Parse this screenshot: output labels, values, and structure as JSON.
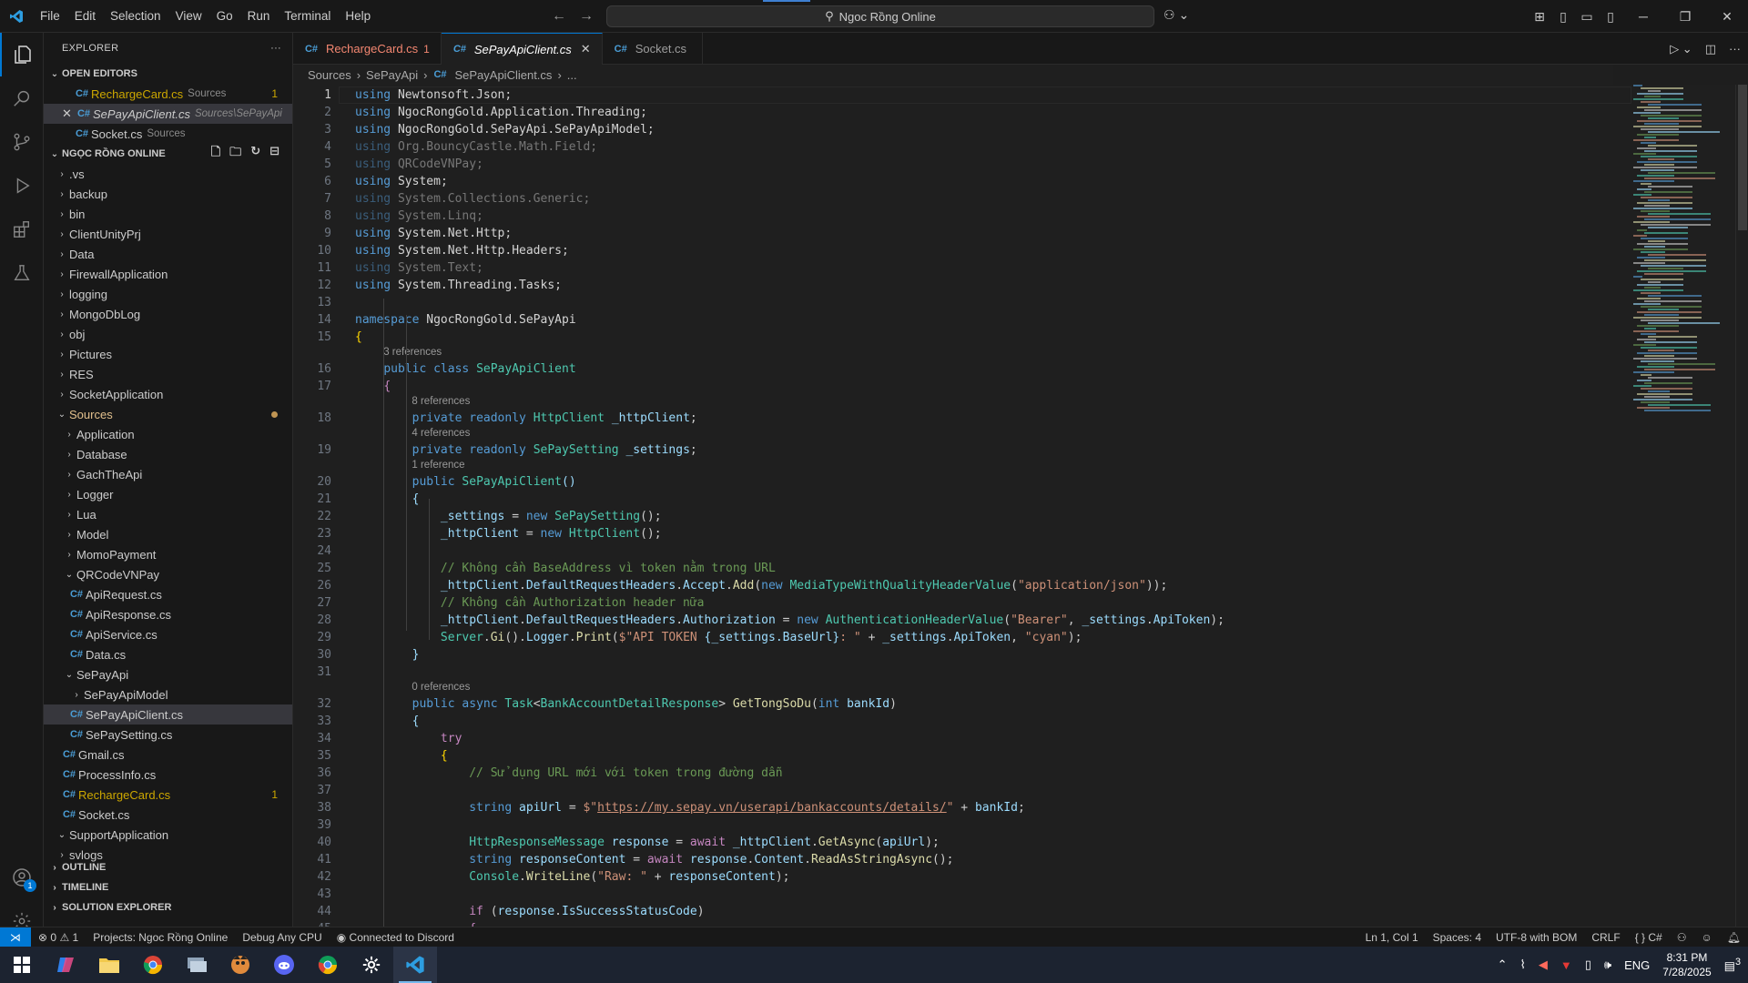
{
  "titlebar": {
    "menu": [
      "File",
      "Edit",
      "Selection",
      "View",
      "Go",
      "Run",
      "Terminal",
      "Help"
    ],
    "search": "Ngoc Rồng Online"
  },
  "explorer": {
    "title": "EXPLORER",
    "open_editors_title": "OPEN EDITORS",
    "open_editors": [
      {
        "name": "RechargeCard.cs",
        "desc": "Sources",
        "count": "1"
      },
      {
        "name": "SePayApiClient.cs",
        "desc": "Sources\\SePayApi",
        "count": ""
      },
      {
        "name": "Socket.cs",
        "desc": "Sources",
        "count": ""
      }
    ],
    "project_title": "NGỌC RỒNG ONLINE",
    "tree": [
      {
        "label": ".vs",
        "type": "folder",
        "depth": 0,
        "open": false
      },
      {
        "label": "backup",
        "type": "folder",
        "depth": 0,
        "open": false
      },
      {
        "label": "bin",
        "type": "folder",
        "depth": 0,
        "open": false
      },
      {
        "label": "ClientUnityPrj",
        "type": "folder",
        "depth": 0,
        "open": false
      },
      {
        "label": "Data",
        "type": "folder",
        "depth": 0,
        "open": false
      },
      {
        "label": "FirewallApplication",
        "type": "folder",
        "depth": 0,
        "open": false
      },
      {
        "label": "logging",
        "type": "folder",
        "depth": 0,
        "open": false
      },
      {
        "label": "MongoDbLog",
        "type": "folder",
        "depth": 0,
        "open": false
      },
      {
        "label": "obj",
        "type": "folder",
        "depth": 0,
        "open": false
      },
      {
        "label": "Pictures",
        "type": "folder",
        "depth": 0,
        "open": false
      },
      {
        "label": "RES",
        "type": "folder",
        "depth": 0,
        "open": false
      },
      {
        "label": "SocketApplication",
        "type": "folder",
        "depth": 0,
        "open": false
      },
      {
        "label": "Sources",
        "type": "folder",
        "depth": 0,
        "open": true,
        "warn": true
      },
      {
        "label": "Application",
        "type": "folder",
        "depth": 1,
        "open": false
      },
      {
        "label": "Database",
        "type": "folder",
        "depth": 1,
        "open": false
      },
      {
        "label": "GachTheApi",
        "type": "folder",
        "depth": 1,
        "open": false
      },
      {
        "label": "Logger",
        "type": "folder",
        "depth": 1,
        "open": false
      },
      {
        "label": "Lua",
        "type": "folder",
        "depth": 1,
        "open": false
      },
      {
        "label": "Model",
        "type": "folder",
        "depth": 1,
        "open": false
      },
      {
        "label": "MomoPayment",
        "type": "folder",
        "depth": 1,
        "open": false
      },
      {
        "label": "QRCodeVNPay",
        "type": "folder",
        "depth": 1,
        "open": true
      },
      {
        "label": "ApiRequest.cs",
        "type": "file",
        "depth": 2
      },
      {
        "label": "ApiResponse.cs",
        "type": "file",
        "depth": 2
      },
      {
        "label": "ApiService.cs",
        "type": "file",
        "depth": 2
      },
      {
        "label": "Data.cs",
        "type": "file",
        "depth": 2
      },
      {
        "label": "SePayApi",
        "type": "folder",
        "depth": 1,
        "open": true
      },
      {
        "label": "SePayApiModel",
        "type": "folder",
        "depth": 2,
        "open": false
      },
      {
        "label": "SePayApiClient.cs",
        "type": "file",
        "depth": 2,
        "selected": true
      },
      {
        "label": "SePaySetting.cs",
        "type": "file",
        "depth": 2
      },
      {
        "label": "Gmail.cs",
        "type": "file",
        "depth": 1
      },
      {
        "label": "ProcessInfo.cs",
        "type": "file",
        "depth": 1
      },
      {
        "label": "RechargeCard.cs",
        "type": "file",
        "depth": 1,
        "error": "1"
      },
      {
        "label": "Socket.cs",
        "type": "file",
        "depth": 1
      },
      {
        "label": "SupportApplication",
        "type": "folder",
        "depth": 0,
        "open": true
      },
      {
        "label": "svlogs",
        "type": "folder",
        "depth": 0,
        "open": false
      }
    ],
    "bottom_sections": [
      "OUTLINE",
      "TIMELINE",
      "SOLUTION EXPLORER"
    ]
  },
  "tabs": [
    {
      "label": "RechargeCard.cs",
      "count": "1",
      "active": false
    },
    {
      "label": "SePayApiClient.cs",
      "count": "",
      "active": true
    },
    {
      "label": "Socket.cs",
      "count": "",
      "active": false
    }
  ],
  "breadcrumb": [
    "Sources",
    "SePayApi",
    "SePayApiClient.cs",
    "..."
  ],
  "editor": {
    "lines": [
      {
        "n": "1",
        "html": "<span class='k'>using</span> <span class='ns'>Newtonsoft.Json</span>;"
      },
      {
        "n": "2",
        "html": "<span class='k'>using</span> <span class='ns'>NgocRongGold.Application.Threading</span>;"
      },
      {
        "n": "3",
        "html": "<span class='k'>using</span> <span class='ns'>NgocRongGold.SePayApi.SePayApiModel</span>;"
      },
      {
        "n": "4",
        "html": "<span class='dim'><span class='k'>using</span> Org.BouncyCastle.Math.Field;</span>"
      },
      {
        "n": "5",
        "html": "<span class='dim'><span class='k'>using</span> QRCodeVNPay;</span>"
      },
      {
        "n": "6",
        "html": "<span class='k'>using</span> <span class='ns'>System</span>;"
      },
      {
        "n": "7",
        "html": "<span class='dim'><span class='k'>using</span> System.Collections.Generic;</span>"
      },
      {
        "n": "8",
        "html": "<span class='dim'><span class='k'>using</span> System.Linq;</span>"
      },
      {
        "n": "9",
        "html": "<span class='k'>using</span> <span class='ns'>System.Net.Http</span>;"
      },
      {
        "n": "10",
        "html": "<span class='k'>using</span> <span class='ns'>System.Net.Http.Headers</span>;"
      },
      {
        "n": "11",
        "html": "<span class='dim'><span class='k'>using</span> System.Text;</span>"
      },
      {
        "n": "12",
        "html": "<span class='k'>using</span> <span class='ns'>System.Threading.Tasks</span>;"
      },
      {
        "n": "13",
        "html": ""
      },
      {
        "n": "14",
        "html": "<span class='k'>namespace</span> <span class='ns'>NgocRongGold.SePayApi</span>"
      },
      {
        "n": "15",
        "html": "<span class='y'>{</span>"
      },
      {
        "n": "16",
        "html": "    <span class='k'>public</span> <span class='k'>class</span> <span class='t'>SePayApiClient</span>",
        "lens": "3 references"
      },
      {
        "n": "17",
        "html": "    <span class='kc'>{</span>"
      },
      {
        "n": "18",
        "html": "        <span class='k'>private</span> <span class='k'>readonly</span> <span class='t'>HttpClient</span> <span class='v'>_httpClient</span>;",
        "lens": "8 references"
      },
      {
        "n": "19",
        "html": "        <span class='k'>private</span> <span class='k'>readonly</span> <span class='t'>SePaySetting</span> <span class='v'>_settings</span>;",
        "lens": "4 references"
      },
      {
        "n": "20",
        "html": "        <span class='k'>public</span> <span class='t'>SePayApiClient</span><span class='v'>()</span>",
        "lens": "1 reference"
      },
      {
        "n": "21",
        "html": "        <span class='v'>{</span>"
      },
      {
        "n": "22",
        "html": "            <span class='v'>_settings</span> = <span class='k'>new</span> <span class='t'>SePaySetting</span>();"
      },
      {
        "n": "23",
        "html": "            <span class='v'>_httpClient</span> = <span class='k'>new</span> <span class='t'>HttpClient</span>();"
      },
      {
        "n": "24",
        "html": ""
      },
      {
        "n": "25",
        "html": "            <span class='c'>// Không cần BaseAddress vì token nằm trong URL</span>"
      },
      {
        "n": "26",
        "html": "            <span class='v'>_httpClient</span>.<span class='v'>DefaultRequestHeaders</span>.<span class='v'>Accept</span>.<span class='f'>Add</span>(<span class='k'>new</span> <span class='t'>MediaTypeWithQualityHeaderValue</span>(<span class='s'>\"application/json\"</span>));"
      },
      {
        "n": "27",
        "html": "            <span class='c'>// Không cần Authorization header nữa</span>"
      },
      {
        "n": "28",
        "html": "            <span class='v'>_httpClient</span>.<span class='v'>DefaultRequestHeaders</span>.<span class='v'>Authorization</span> = <span class='k'>new</span> <span class='t'>AuthenticationHeaderValue</span>(<span class='s'>\"Bearer\"</span>, <span class='v'>_settings</span>.<span class='v'>ApiToken</span>);"
      },
      {
        "n": "29",
        "html": "            <span class='t'>Server</span>.<span class='f'>Gi</span>().<span class='v'>Logger</span>.<span class='f'>Print</span>(<span class='s'>$\"API TOKEN </span><span class='v'>{_settings.BaseUrl}</span><span class='s'>: \"</span> + <span class='v'>_settings</span>.<span class='v'>ApiToken</span>, <span class='s'>\"cyan\"</span>);"
      },
      {
        "n": "30",
        "html": "        <span class='v'>}</span>"
      },
      {
        "n": "31",
        "html": ""
      },
      {
        "n": "32",
        "html": "        <span class='k'>public</span> <span class='k'>async</span> <span class='t'>Task</span>&lt;<span class='t'>BankAccountDetailResponse</span>&gt; <span class='f'>GetTongSoDu</span>(<span class='k'>int</span> <span class='v'>bankId</span>)",
        "lens": "0 references"
      },
      {
        "n": "33",
        "html": "        <span class='v'>{</span>"
      },
      {
        "n": "34",
        "html": "            <span class='kc'>try</span>"
      },
      {
        "n": "35",
        "html": "            <span class='y'>{</span>"
      },
      {
        "n": "36",
        "html": "                <span class='c'>// Sử dụng URL mới với token trong đường dẫn</span>"
      },
      {
        "n": "37",
        "html": ""
      },
      {
        "n": "38",
        "html": "                <span class='k'>string</span> <span class='v'>apiUrl</span> = <span class='s'>$\"<span class='u'>https://my.sepay.vn/userapi/bankaccounts/details/</span>\"</span> + <span class='v'>bankId</span>;"
      },
      {
        "n": "39",
        "html": ""
      },
      {
        "n": "40",
        "html": "                <span class='t'>HttpResponseMessage</span> <span class='v'>response</span> = <span class='kc'>await</span> <span class='v'>_httpClient</span>.<span class='f'>GetAsync</span>(<span class='v'>apiUrl</span>);"
      },
      {
        "n": "41",
        "html": "                <span class='k'>string</span> <span class='v'>responseContent</span> = <span class='kc'>await</span> <span class='v'>response</span>.<span class='v'>Content</span>.<span class='f'>ReadAsStringAsync</span>();"
      },
      {
        "n": "42",
        "html": "                <span class='t'>Console</span>.<span class='f'>WriteLine</span>(<span class='s'>\"Raw: \"</span> + <span class='v'>responseContent</span>);"
      },
      {
        "n": "43",
        "html": ""
      },
      {
        "n": "44",
        "html": "                <span class='kc'>if</span> (<span class='v'>response</span>.<span class='v'>IsSuccessStatusCode</span>)"
      },
      {
        "n": "45",
        "html": "                <span class='kc'>{</span>"
      }
    ]
  },
  "statusbar": {
    "problems": "0",
    "warnings": "1",
    "project": "Projects: Ngoc Rồng Online",
    "config": "Debug Any CPU",
    "discord": "Connected to Discord",
    "position": "Ln 1, Col 1",
    "spaces": "Spaces: 4",
    "encoding": "UTF-8 with BOM",
    "eol": "CRLF",
    "language": "C#"
  },
  "taskbar": {
    "lang": "ENG",
    "time": "8:31 PM",
    "date": "7/28/2025",
    "notifications": "3"
  },
  "accounts_badge": "1"
}
